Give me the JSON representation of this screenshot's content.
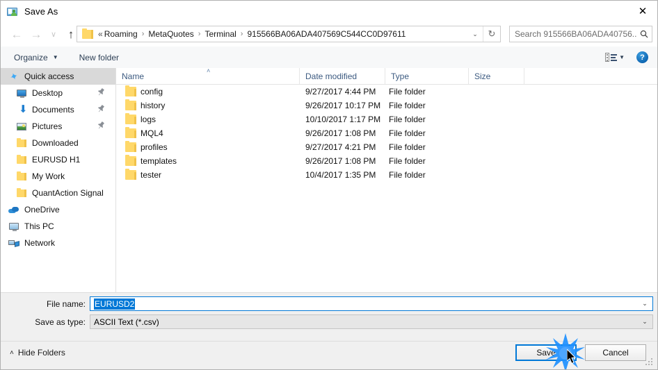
{
  "window": {
    "title": "Save As",
    "icon": "save-as-app-icon",
    "close_label": "✕"
  },
  "nav": {
    "back_icon": "←",
    "forward_icon": "→",
    "recent_icon": "∨",
    "up_icon": "↑",
    "refresh_icon": "↻",
    "dropdown_icon": "⌄"
  },
  "address": {
    "leading": "«",
    "separator": "›",
    "crumbs": [
      "Roaming",
      "MetaQuotes",
      "Terminal",
      "915566BA06ADA407569C544CC0D97611"
    ]
  },
  "search": {
    "placeholder": "Search 915566BA06ADA40756...",
    "icon": "🔍"
  },
  "toolbar": {
    "organize_label": "Organize",
    "organize_caret": "▼",
    "new_folder_label": "New folder",
    "view_caret": "▼",
    "help_label": "?"
  },
  "sidebar": {
    "items": [
      {
        "label": "Quick access",
        "icon": "star-icon",
        "selected": true,
        "pinned": false,
        "root": true
      },
      {
        "label": "Desktop",
        "icon": "desktop-icon",
        "selected": false,
        "pinned": true,
        "root": false
      },
      {
        "label": "Documents",
        "icon": "documents-download-icon",
        "selected": false,
        "pinned": true,
        "root": false
      },
      {
        "label": "Pictures",
        "icon": "pictures-icon",
        "selected": false,
        "pinned": true,
        "root": false
      },
      {
        "label": "Downloaded",
        "icon": "folder-icon",
        "selected": false,
        "pinned": false,
        "root": false
      },
      {
        "label": "EURUSD H1",
        "icon": "folder-icon",
        "selected": false,
        "pinned": false,
        "root": false
      },
      {
        "label": "My Work",
        "icon": "folder-icon",
        "selected": false,
        "pinned": false,
        "root": false
      },
      {
        "label": "QuantAction Signal",
        "icon": "folder-icon",
        "selected": false,
        "pinned": false,
        "root": false
      },
      {
        "label": "OneDrive",
        "icon": "onedrive-icon",
        "selected": false,
        "pinned": false,
        "root": true
      },
      {
        "label": "This PC",
        "icon": "this-pc-icon",
        "selected": false,
        "pinned": false,
        "root": true
      },
      {
        "label": "Network",
        "icon": "network-icon",
        "selected": false,
        "pinned": false,
        "root": true
      }
    ],
    "pin_icon": "📌"
  },
  "filelist": {
    "columns": [
      "Name",
      "Date modified",
      "Type",
      "Size"
    ],
    "sort_caret": "˄",
    "rows": [
      {
        "name": "config",
        "date": "9/27/2017 4:44 PM",
        "type": "File folder",
        "size": ""
      },
      {
        "name": "history",
        "date": "9/26/2017 10:17 PM",
        "type": "File folder",
        "size": ""
      },
      {
        "name": "logs",
        "date": "10/10/2017 1:17 PM",
        "type": "File folder",
        "size": ""
      },
      {
        "name": "MQL4",
        "date": "9/26/2017 1:08 PM",
        "type": "File folder",
        "size": ""
      },
      {
        "name": "profiles",
        "date": "9/27/2017 4:21 PM",
        "type": "File folder",
        "size": ""
      },
      {
        "name": "templates",
        "date": "9/26/2017 1:08 PM",
        "type": "File folder",
        "size": ""
      },
      {
        "name": "tester",
        "date": "10/4/2017 1:35 PM",
        "type": "File folder",
        "size": ""
      }
    ]
  },
  "form": {
    "filename_label": "File name:",
    "filename_value": "EURUSD2",
    "savetype_label": "Save as type:",
    "savetype_value": "ASCII Text (*.csv)",
    "dropdown_icon": "⌄"
  },
  "footer": {
    "hide_folders_label": "Hide Folders",
    "hide_folders_caret": "˄",
    "save_label": "Save",
    "cancel_label": "Cancel"
  },
  "colors": {
    "accent": "#0078d7",
    "selection": "#0078d7",
    "sidebar_selected": "#d9d9d9",
    "folder_yellow": "#ffd869",
    "header_text": "#3c5a80",
    "panel": "#f0f0f0"
  }
}
